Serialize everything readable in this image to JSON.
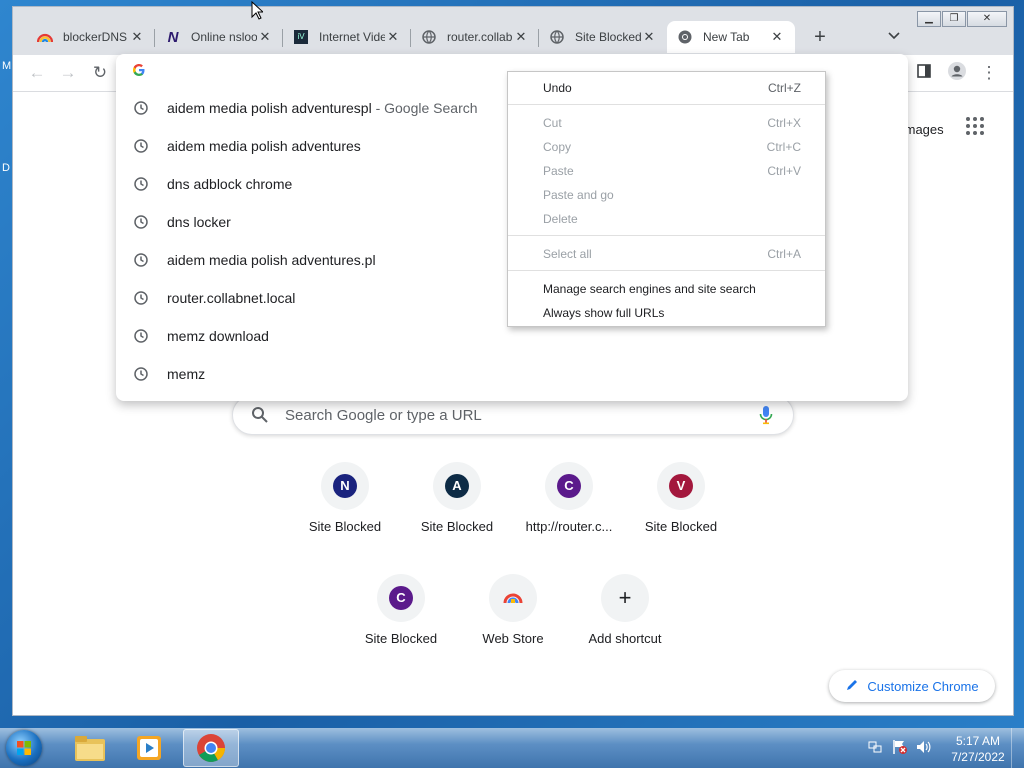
{
  "tabs": [
    {
      "title": "blockerDNS",
      "favicon": "rainbow-icon"
    },
    {
      "title": "Online nslookup",
      "favicon": "n-logo-icon"
    },
    {
      "title": "Internet Video",
      "favicon": "video-site-icon"
    },
    {
      "title": "router.collabnet.local",
      "favicon": "globe-icon"
    },
    {
      "title": "Site Blocked",
      "favicon": "globe-icon"
    },
    {
      "title": "New Tab",
      "favicon": "chrome-icon"
    }
  ],
  "omnibox": {
    "value": "",
    "suggestions": [
      {
        "text": "aidem media polish adventurespl",
        "suffix": "- Google Search"
      },
      {
        "text": "aidem media polish adventures",
        "suffix": ""
      },
      {
        "text": "dns adblock chrome",
        "suffix": ""
      },
      {
        "text": "dns locker",
        "suffix": ""
      },
      {
        "text": "aidem media polish adventures.pl",
        "suffix": ""
      },
      {
        "text": "router.collabnet.local",
        "suffix": ""
      },
      {
        "text": "memz download",
        "suffix": ""
      },
      {
        "text": "memz",
        "suffix": ""
      }
    ]
  },
  "context_menu": {
    "undo": {
      "label": "Undo",
      "shortcut": "Ctrl+Z"
    },
    "cut": {
      "label": "Cut",
      "shortcut": "Ctrl+X"
    },
    "copy": {
      "label": "Copy",
      "shortcut": "Ctrl+C"
    },
    "paste": {
      "label": "Paste",
      "shortcut": "Ctrl+V"
    },
    "paste_go": {
      "label": "Paste and go",
      "shortcut": ""
    },
    "delete": {
      "label": "Delete",
      "shortcut": ""
    },
    "select_all": {
      "label": "Select all",
      "shortcut": "Ctrl+A"
    },
    "manage_search": {
      "label": "Manage search engines and site search",
      "shortcut": ""
    },
    "full_urls": {
      "label": "Always show full URLs",
      "shortcut": ""
    }
  },
  "ntp": {
    "images_link": "Images",
    "search_placeholder": "Search Google or type a URL",
    "shortcuts": [
      {
        "letter": "N",
        "color": "#1a237e",
        "label": "Site Blocked"
      },
      {
        "letter": "A",
        "color": "#0d2b45",
        "label": "Site Blocked"
      },
      {
        "letter": "C",
        "color": "#5b1a8b",
        "label": "http://router.c..."
      },
      {
        "letter": "V",
        "color": "#a3183d",
        "label": "Site Blocked"
      },
      {
        "letter": "C",
        "color": "#5b1a8b",
        "label": "Site Blocked"
      },
      {
        "letter": "",
        "color": "",
        "label": "Web Store"
      },
      {
        "letter": "+",
        "color": "",
        "label": "Add shortcut"
      }
    ],
    "customize_label": "Customize Chrome"
  },
  "taskbar": {
    "time": "5:17 AM",
    "date": "7/27/2022"
  },
  "colors": {
    "accent": "#1a73e8",
    "tab_strip": "#dee1e6"
  }
}
